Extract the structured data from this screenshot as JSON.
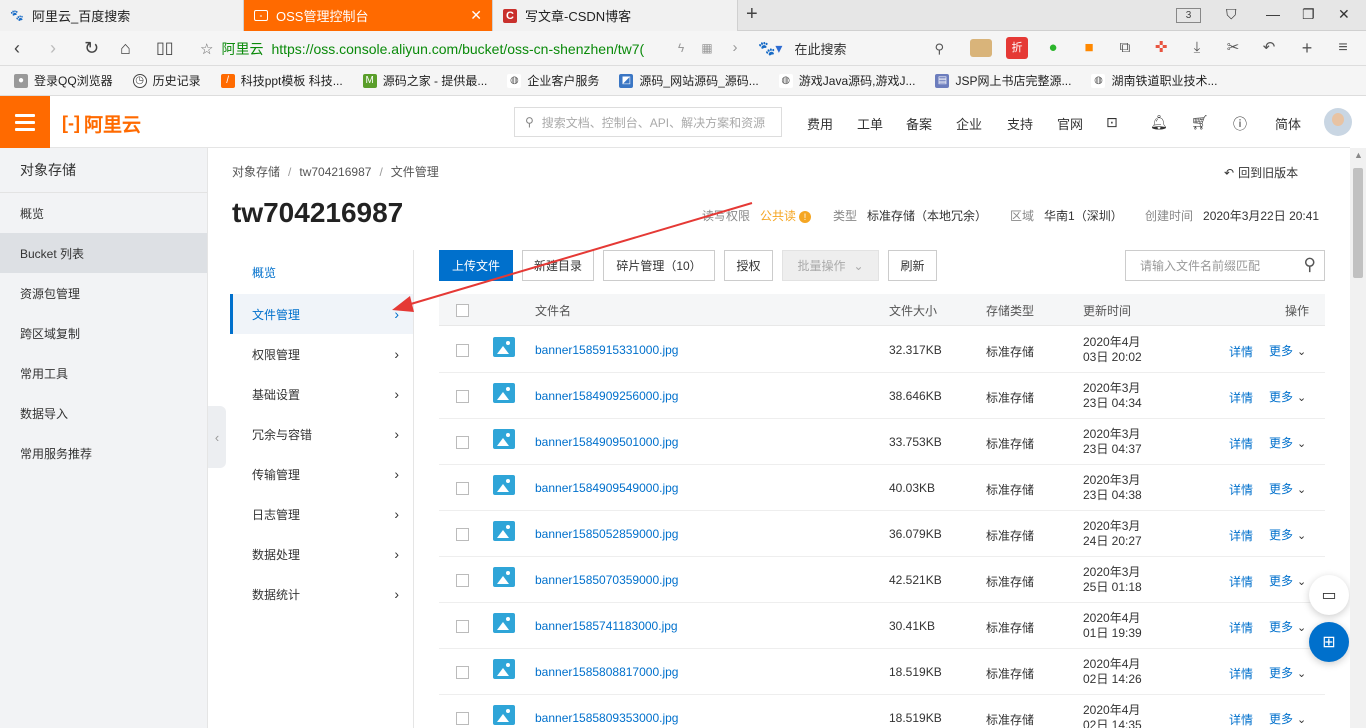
{
  "browser": {
    "tabs": [
      {
        "title": "阿里云_百度搜索",
        "icon": "paw-icon"
      },
      {
        "title": "OSS管理控制台",
        "icon": "aliyun-icon"
      },
      {
        "title": "写文章-CSDN博客",
        "icon": "csdn-icon"
      }
    ],
    "tab_count": "3",
    "address": {
      "site_name": "阿里云",
      "url": "https://oss.console.aliyun.com/bucket/oss-cn-shenzhen/tw7("
    },
    "search_placeholder": "在此搜索",
    "bookmarks": [
      "登录QQ浏览器",
      "历史记录",
      "科技ppt模板 科技...",
      "源码之家 - 提供最...",
      "企业客户服务",
      "源码_网站源码_源码...",
      "游戏Java源码,游戏J...",
      "JSP网上书店完整源...",
      "湖南铁道职业技术..."
    ]
  },
  "topnav": {
    "logo_text": "阿里云",
    "search_placeholder": "搜索文档、控制台、API、解决方案和资源",
    "items": [
      "费用",
      "工单",
      "备案",
      "企业",
      "支持",
      "官网"
    ],
    "lang": "简体"
  },
  "sidebar": {
    "title": "对象存储",
    "items": [
      "概览",
      "Bucket 列表",
      "资源包管理",
      "跨区域复制",
      "常用工具",
      "数据导入",
      "常用服务推荐"
    ],
    "active_index": 1
  },
  "breadcrumb": [
    "对象存储",
    "tw704216987",
    "文件管理"
  ],
  "old_version": "回到旧版本",
  "bucket": {
    "name": "tw704216987",
    "acl_label": "读写权限",
    "acl_value": "公共读",
    "type_label": "类型",
    "type_value": "标准存储（本地冗余）",
    "region_label": "区域",
    "region_value": "华南1（深圳）",
    "created_label": "创建时间",
    "created_value": "2020年3月22日 20:41"
  },
  "subnav": {
    "items": [
      "概览",
      "文件管理",
      "权限管理",
      "基础设置",
      "冗余与容错",
      "传输管理",
      "日志管理",
      "数据处理",
      "数据统计"
    ],
    "active_index": 1
  },
  "toolbar": {
    "upload": "上传文件",
    "new_dir": "新建目录",
    "fragments": "碎片管理（10）",
    "authorize": "授权",
    "batch": "批量操作",
    "refresh": "刷新",
    "search_placeholder": "请输入文件名前缀匹配"
  },
  "table": {
    "headers": {
      "name": "文件名",
      "size": "文件大小",
      "storage": "存储类型",
      "updated": "更新时间",
      "actions": "操作"
    },
    "detail_label": "详情",
    "more_label": "更多",
    "rows": [
      {
        "name": "banner1585915331000.jpg",
        "size": "32.317KB",
        "storage": "标准存储",
        "date1": "2020年4月",
        "date2": "03日 20:02"
      },
      {
        "name": "banner1584909256000.jpg",
        "size": "38.646KB",
        "storage": "标准存储",
        "date1": "2020年3月",
        "date2": "23日 04:34"
      },
      {
        "name": "banner1584909501000.jpg",
        "size": "33.753KB",
        "storage": "标准存储",
        "date1": "2020年3月",
        "date2": "23日 04:37"
      },
      {
        "name": "banner1584909549000.jpg",
        "size": "40.03KB",
        "storage": "标准存储",
        "date1": "2020年3月",
        "date2": "23日 04:38"
      },
      {
        "name": "banner1585052859000.jpg",
        "size": "36.079KB",
        "storage": "标准存储",
        "date1": "2020年3月",
        "date2": "24日 20:27"
      },
      {
        "name": "banner1585070359000.jpg",
        "size": "42.521KB",
        "storage": "标准存储",
        "date1": "2020年3月",
        "date2": "25日 01:18"
      },
      {
        "name": "banner1585741183000.jpg",
        "size": "30.41KB",
        "storage": "标准存储",
        "date1": "2020年4月",
        "date2": "01日 19:39"
      },
      {
        "name": "banner1585808817000.jpg",
        "size": "18.519KB",
        "storage": "标准存储",
        "date1": "2020年4月",
        "date2": "02日 14:26"
      },
      {
        "name": "banner1585809353000.jpg",
        "size": "18.519KB",
        "storage": "标准存储",
        "date1": "2020年4月",
        "date2": "02日 14:35"
      }
    ]
  },
  "colors": {
    "accent": "#ff6a00",
    "link": "#0070cc",
    "annotation_arrow": "#e53935"
  }
}
